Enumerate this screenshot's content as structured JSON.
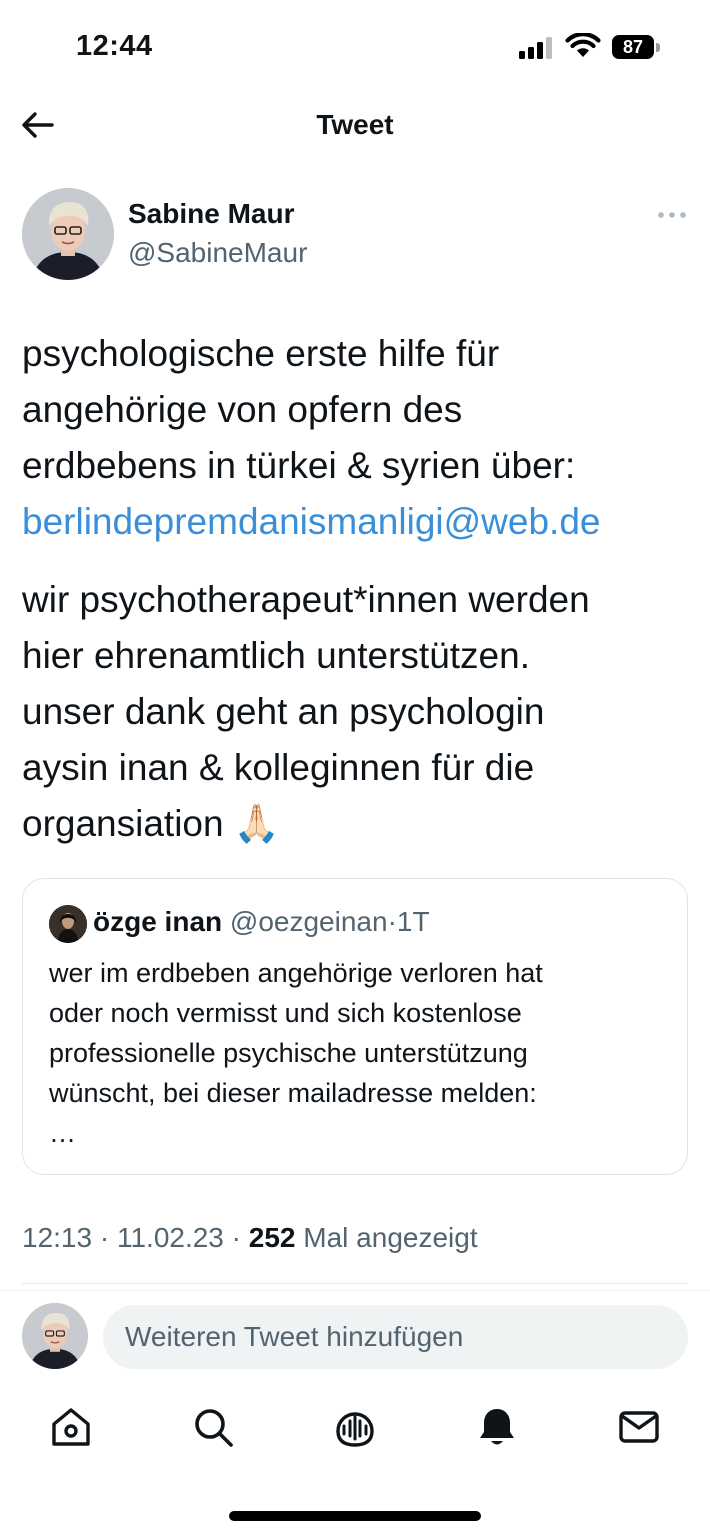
{
  "status_bar": {
    "time": "12:44",
    "battery": "87"
  },
  "nav": {
    "title": "Tweet"
  },
  "author": {
    "name": "Sabine Maur",
    "handle": "@SabineMaur"
  },
  "tweet": {
    "lines_1": [
      "psychologische erste hilfe für",
      "angehörige von opfern des",
      "erdbebens in türkei & syrien über:"
    ],
    "link": "berlindepremdanismanligi@web.de",
    "lines_2": [
      "wir psychotherapeut*innen werden",
      "hier ehrenamtlich unterstützen.",
      "unser dank geht an psychologin",
      "aysin inan & kolleginnen für die"
    ],
    "last_line": "organsiation",
    "emoji": "🙏🏻"
  },
  "quoted_tweet": {
    "name": "özge inan",
    "handle": "@oezgeinan",
    "separator": "·",
    "time": "1T",
    "body_lines": [
      "wer im erdbeben angehörige verloren hat",
      "oder noch vermisst und sich kostenlose",
      "professionelle psychische unterstützung",
      "wünscht, bei dieser mailadresse melden:",
      "…"
    ]
  },
  "meta": {
    "time": "12:13",
    "separator": "·",
    "date": "11.02.23",
    "views_count": "252",
    "views_label": "Mal angezeigt"
  },
  "reply": {
    "placeholder": "Weiteren Tweet hinzufügen"
  },
  "tabs": [
    "home-icon",
    "search-icon",
    "spaces-icon",
    "notifications-icon",
    "messages-icon"
  ],
  "colors": {
    "link": "#3b8fd8",
    "secondary_text": "#536471",
    "primary_text": "#0f1419",
    "input_bg": "#eff3f4"
  }
}
